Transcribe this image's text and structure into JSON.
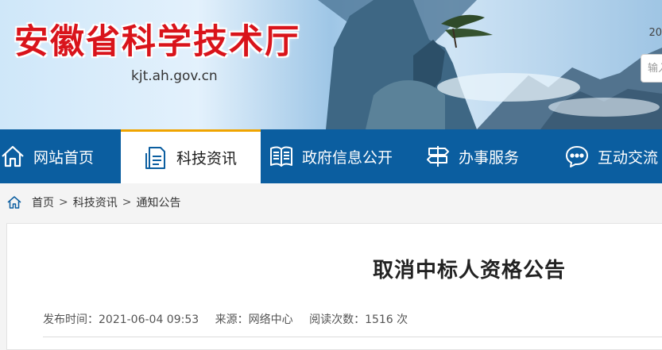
{
  "header": {
    "site_title": "安徽省科学技术厅",
    "site_url": "kjt.ah.gov.cn",
    "date_text": "20",
    "search_placeholder": "输入"
  },
  "nav": {
    "items": [
      {
        "label": "网站首页",
        "icon": "home-icon",
        "active": false
      },
      {
        "label": "科技资讯",
        "icon": "document-icon",
        "active": true
      },
      {
        "label": "政府信息公开",
        "icon": "book-icon",
        "active": false
      },
      {
        "label": "办事服务",
        "icon": "signpost-icon",
        "active": false
      },
      {
        "label": "互动交流",
        "icon": "chat-icon",
        "active": false
      }
    ]
  },
  "breadcrumb": {
    "home": "首页",
    "level1": "科技资讯",
    "level2": "通知公告",
    "separator": ">"
  },
  "article": {
    "title": "取消中标人资格公告",
    "publish_label": "发布时间：2021-06-04 09:53",
    "source_label": "来源：网络中心",
    "views_label": "阅读次数：1516 次"
  },
  "colors": {
    "nav_bg": "#0b5ea0",
    "title_red": "#d9141b",
    "active_accent": "#f0a400"
  }
}
